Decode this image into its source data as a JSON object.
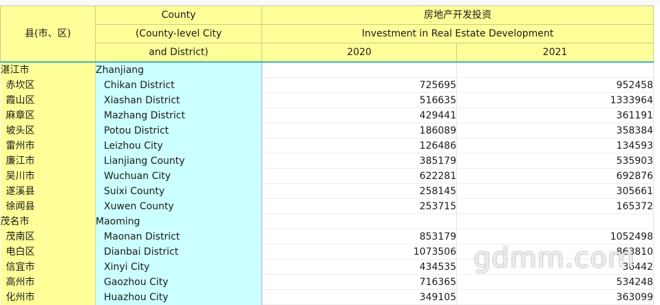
{
  "header": {
    "county_zh": "县(市、区)",
    "county_en_1": "County",
    "county_en_2": "(County-level City",
    "county_en_3": "and District)",
    "metric_zh": "房地产开发投资",
    "metric_en": "Investment in Real Estate Development",
    "years": [
      "2020",
      "2021"
    ]
  },
  "rows": [
    {
      "zh": "湛江市",
      "en": "Zhanjiang",
      "v2020": "",
      "v2021": "",
      "group": true
    },
    {
      "zh": "赤坎区",
      "en": "Chikan District",
      "v2020": "725695",
      "v2021": "952458"
    },
    {
      "zh": "霞山区",
      "en": "Xiashan District",
      "v2020": "516635",
      "v2021": "1333964"
    },
    {
      "zh": "麻章区",
      "en": "Mazhang District",
      "v2020": "429441",
      "v2021": "361191"
    },
    {
      "zh": "坡头区",
      "en": "Potou District",
      "v2020": "186089",
      "v2021": "358384"
    },
    {
      "zh": "雷州市",
      "en": "Leizhou City",
      "v2020": "126486",
      "v2021": "134593"
    },
    {
      "zh": "廉江市",
      "en": "Lianjiang County",
      "v2020": "385179",
      "v2021": "535903"
    },
    {
      "zh": "吴川市",
      "en": "Wuchuan City",
      "v2020": "622281",
      "v2021": "692876"
    },
    {
      "zh": "遂溪县",
      "en": "Suixi County",
      "v2020": "258145",
      "v2021": "305661"
    },
    {
      "zh": "徐闻县",
      "en": "Xuwen County",
      "v2020": "253715",
      "v2021": "165372"
    },
    {
      "zh": "茂名市",
      "en": "Maoming",
      "v2020": "",
      "v2021": "",
      "group": true
    },
    {
      "zh": "茂南区",
      "en": "Maonan District",
      "v2020": "853179",
      "v2021": "1052498"
    },
    {
      "zh": "电白区",
      "en": "Dianbai District",
      "v2020": "1073506",
      "v2021": "863810"
    },
    {
      "zh": "信宜市",
      "en": "Xinyi City",
      "v2020": "434535",
      "v2021": "36442"
    },
    {
      "zh": "高州市",
      "en": "Gaozhou City",
      "v2020": "716365",
      "v2021": "534248"
    },
    {
      "zh": "化州市",
      "en": "Huazhou City",
      "v2020": "349105",
      "v2021": "363099"
    }
  ],
  "watermark": "gdmm.com"
}
